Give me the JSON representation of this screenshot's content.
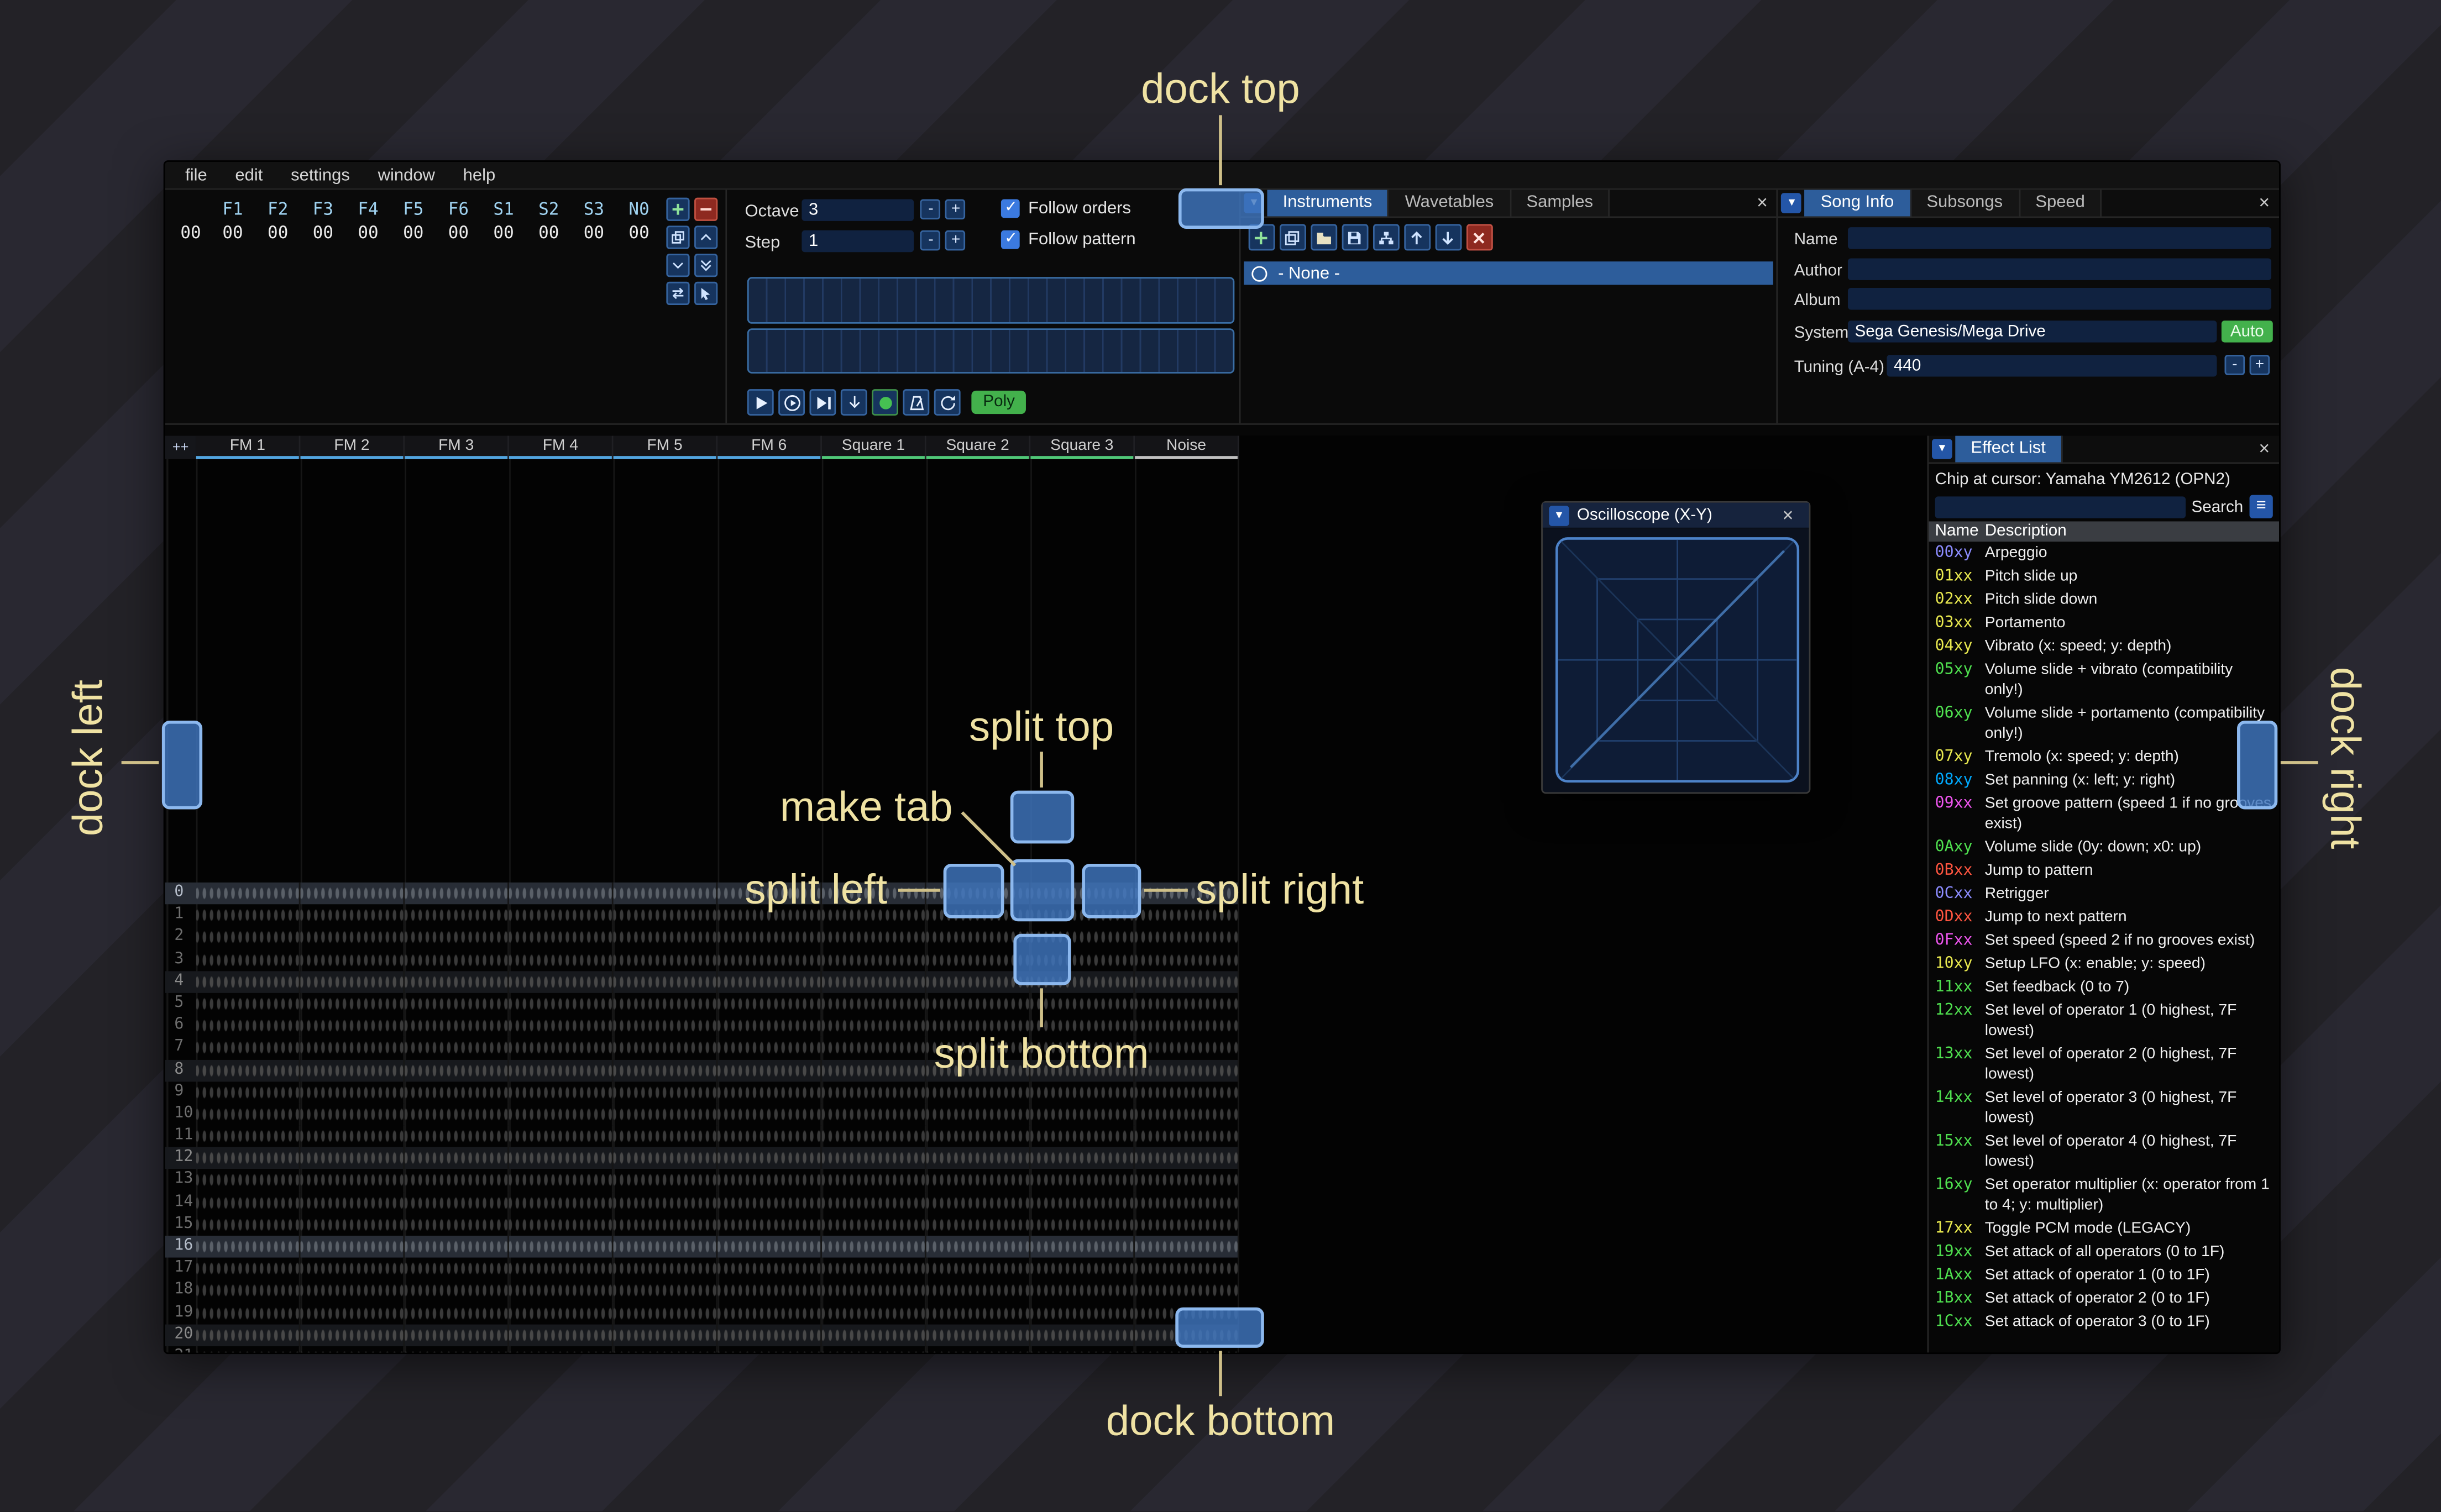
{
  "glyphs": {
    "close": "×",
    "collapse": "▼",
    "minus": "-",
    "plus": "+",
    "check": "✓",
    "hamburger": "≡",
    "circle": "○"
  },
  "menu": {
    "items": [
      "file",
      "edit",
      "settings",
      "window",
      "help"
    ]
  },
  "orders": {
    "row_number": "00",
    "channels": [
      "F1",
      "F2",
      "F3",
      "F4",
      "F5",
      "F6",
      "S1",
      "S2",
      "S3",
      "N0"
    ],
    "values": [
      "00",
      "00",
      "00",
      "00",
      "00",
      "00",
      "00",
      "00",
      "00",
      "00"
    ],
    "buttons": [
      "add",
      "remove",
      "duplicate",
      "move-up",
      "move-down",
      "duplicate-end",
      "swap",
      "edit"
    ]
  },
  "controls": {
    "octave_label": "Octave",
    "octave_value": "3",
    "step_label": "Step",
    "step_value": "1",
    "follow_orders": "Follow orders",
    "follow_pattern": "Follow pattern",
    "poly_label": "Poly",
    "transport": [
      "play",
      "play-pattern",
      "play-from-cursor",
      "step-one-row",
      "stop",
      "metronome",
      "repeat"
    ]
  },
  "instruments": {
    "tabs": [
      "Instruments",
      "Wavetables",
      "Samples"
    ],
    "active_tab": "Instruments",
    "toolbar": [
      "add",
      "clone",
      "open",
      "save",
      "organize",
      "move-up",
      "move-down",
      "delete"
    ],
    "list": [
      {
        "label": "- None -",
        "selected": true
      }
    ]
  },
  "song_info": {
    "tabs": [
      "Song Info",
      "Subsongs",
      "Speed"
    ],
    "active_tab": "Song Info",
    "name_label": "Name",
    "name_value": "",
    "author_label": "Author",
    "author_value": "",
    "album_label": "Album",
    "album_value": "",
    "system_label": "System",
    "system_value": "Sega Genesis/Mega Drive",
    "auto_button": "Auto",
    "tuning_label": "Tuning (A-4)",
    "tuning_value": "440"
  },
  "pattern": {
    "corner": "++",
    "visible_rows": 22,
    "channels": [
      {
        "name": "FM 1",
        "type": "fm"
      },
      {
        "name": "FM 2",
        "type": "fm"
      },
      {
        "name": "FM 3",
        "type": "fm"
      },
      {
        "name": "FM 4",
        "type": "fm"
      },
      {
        "name": "FM 5",
        "type": "fm"
      },
      {
        "name": "FM 6",
        "type": "fm"
      },
      {
        "name": "Square 1",
        "type": "square"
      },
      {
        "name": "Square 2",
        "type": "square"
      },
      {
        "name": "Square 3",
        "type": "square"
      },
      {
        "name": "Noise",
        "type": "noise"
      }
    ]
  },
  "colors": {
    "channel_types": {
      "fm": "#52a5e0",
      "square": "#50c878",
      "noise": "#c0c0c0"
    },
    "accent": "#2d5d9b",
    "dock_target": "#4076c0",
    "overlay_label": "#efe2a3"
  },
  "oscilloscope": {
    "title": "Oscilloscope (X-Y)"
  },
  "effect_list": {
    "title": "Effect List",
    "chip_line": "Chip at cursor: Yamaha YM2612 (OPN2)",
    "search_label": "Search",
    "search_value": "",
    "columns": [
      "Name",
      "Description"
    ],
    "effects": [
      {
        "code": "00xy",
        "color": "#8c8cff",
        "desc": "Arpeggio"
      },
      {
        "code": "01xx",
        "color": "#e8e84f",
        "desc": "Pitch slide up"
      },
      {
        "code": "02xx",
        "color": "#e8e84f",
        "desc": "Pitch slide down"
      },
      {
        "code": "03xx",
        "color": "#e8e84f",
        "desc": "Portamento"
      },
      {
        "code": "04xy",
        "color": "#e8e84f",
        "desc": "Vibrato (x: speed; y: depth)"
      },
      {
        "code": "05xy",
        "color": "#4fe04f",
        "desc": "Volume slide + vibrato (compatibility only!)"
      },
      {
        "code": "06xy",
        "color": "#4fe04f",
        "desc": "Volume slide + portamento (compatibility only!)"
      },
      {
        "code": "07xy",
        "color": "#e8e84f",
        "desc": "Tremolo (x: speed; y: depth)"
      },
      {
        "code": "08xy",
        "color": "#00aaff",
        "desc": "Set panning (x: left; y: right)"
      },
      {
        "code": "09xx",
        "color": "#ee55ee",
        "desc": "Set groove pattern (speed 1 if no grooves exist)"
      },
      {
        "code": "0Axy",
        "color": "#4fe04f",
        "desc": "Volume slide (0y: down; x0: up)"
      },
      {
        "code": "0Bxx",
        "color": "#ff5540",
        "desc": "Jump to pattern"
      },
      {
        "code": "0Cxx",
        "color": "#8c8cff",
        "desc": "Retrigger"
      },
      {
        "code": "0Dxx",
        "color": "#ff5540",
        "desc": "Jump to next pattern"
      },
      {
        "code": "0Fxx",
        "color": "#ee55ee",
        "desc": "Set speed (speed 2 if no grooves exist)"
      },
      {
        "code": "10xy",
        "color": "#e8e84f",
        "desc": "Setup LFO (x: enable; y: speed)"
      },
      {
        "code": "11xx",
        "color": "#4fe04f",
        "desc": "Set feedback (0 to 7)"
      },
      {
        "code": "12xx",
        "color": "#4fe04f",
        "desc": "Set level of operator 1 (0 highest, 7F lowest)"
      },
      {
        "code": "13xx",
        "color": "#4fe04f",
        "desc": "Set level of operator 2 (0 highest, 7F lowest)"
      },
      {
        "code": "14xx",
        "color": "#4fe04f",
        "desc": "Set level of operator 3 (0 highest, 7F lowest)"
      },
      {
        "code": "15xx",
        "color": "#4fe04f",
        "desc": "Set level of operator 4 (0 highest, 7F lowest)"
      },
      {
        "code": "16xy",
        "color": "#4fe04f",
        "desc": "Set operator multiplier (x: operator from 1 to 4; y: multiplier)"
      },
      {
        "code": "17xx",
        "color": "#e8e84f",
        "desc": "Toggle PCM mode (LEGACY)"
      },
      {
        "code": "19xx",
        "color": "#4fe04f",
        "desc": "Set attack of all operators (0 to 1F)"
      },
      {
        "code": "1Axx",
        "color": "#4fe04f",
        "desc": "Set attack of operator 1 (0 to 1F)"
      },
      {
        "code": "1Bxx",
        "color": "#4fe04f",
        "desc": "Set attack of operator 2 (0 to 1F)"
      },
      {
        "code": "1Cxx",
        "color": "#4fe04f",
        "desc": "Set attack of operator 3 (0 to 1F)"
      }
    ]
  },
  "overlay": {
    "labels": {
      "dock_top": "dock top",
      "dock_bottom": "dock bottom",
      "dock_left": "dock left",
      "dock_right": "dock right",
      "split_top": "split top",
      "split_bottom": "split bottom",
      "split_left": "split left",
      "split_right": "split right",
      "make_tab": "make tab"
    }
  }
}
